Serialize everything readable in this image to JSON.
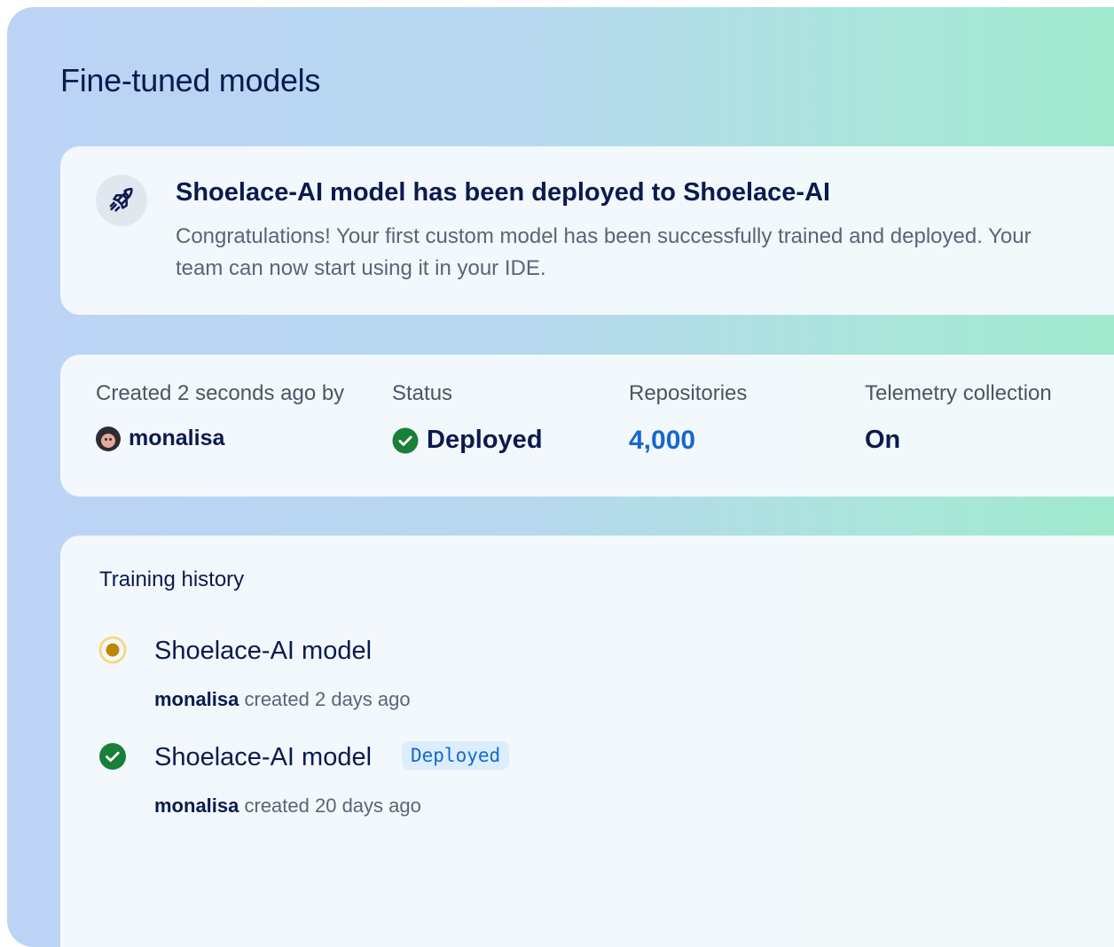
{
  "page": {
    "title": "Fine-tuned models"
  },
  "banner": {
    "icon": "rocket-icon",
    "title": "Shoelace-AI model has been deployed to Shoelace-AI",
    "body": "Congratulations! Your first custom model has been successfully trained and deployed. Your team can now start using it in your IDE."
  },
  "stats": {
    "created": {
      "label": "Created 2 seconds ago by",
      "user": "monalisa",
      "icon": "avatar"
    },
    "status": {
      "label": "Status",
      "value": "Deployed",
      "icon": "check-circle-icon",
      "color": "#1a7f37"
    },
    "repositories": {
      "label": "Repositories",
      "value": "4,000",
      "color": "#1767d0"
    },
    "telemetry": {
      "label": "Telemetry collection",
      "value": "On"
    }
  },
  "history": {
    "title": "Training history",
    "items": [
      {
        "name": "Shoelace-AI model",
        "user": "monalisa",
        "meta": "created 2 days ago",
        "icon": "in-progress-dot-icon",
        "color": "#bf8700"
      },
      {
        "name": "Shoelace-AI model",
        "user": "monalisa",
        "meta": "created 20 days ago",
        "icon": "check-circle-icon",
        "color": "#1a7f37",
        "badge": "Deployed"
      }
    ]
  }
}
